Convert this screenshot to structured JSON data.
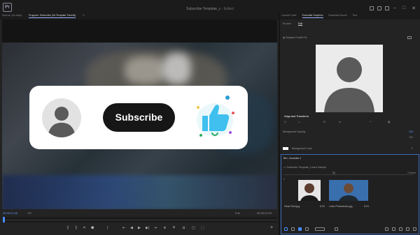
{
  "window": {
    "app_badge": "Pr",
    "title": "Subscribe Template_c",
    "title_suffix": "- Edited",
    "controls": [
      "–",
      "□",
      "✕"
    ]
  },
  "left_tabs": [
    {
      "label": "Source: (no clips)",
      "active": false
    },
    {
      "label": "Program: Subscribe (3d Template Tutorial)",
      "active": true
    }
  ],
  "right_tabs": [
    {
      "label": "Lumetri Color",
      "active": false
    },
    {
      "label": "Essential Graphics",
      "active": true
    },
    {
      "label": "Essential Sound",
      "active": false
    },
    {
      "label": "Text",
      "active": false
    }
  ],
  "overlay": {
    "subscribe_label": "Subscribe",
    "colors": {
      "card": "#ffffff",
      "button": "#161616",
      "like": "#3fc0ef",
      "avatar": "#5a5a5a"
    }
  },
  "program_monitor": {
    "timecode_current": "00:00:21:06",
    "fit_label": "Fit",
    "quality_label": "Full",
    "timecode_duration": "00:00:23:19"
  },
  "transport_icons": [
    "mark-in-icon",
    "mark-out-icon",
    "go-to-in-icon",
    "step-back-icon",
    "play-icon",
    "step-forward-icon",
    "go-to-out-icon",
    "lift-icon",
    "extract-icon",
    "export-frame-icon",
    "add-icon"
  ],
  "essential_graphics": {
    "subtabs": [
      {
        "label": "Browse",
        "active": false
      },
      {
        "label": "Edit",
        "active": true
      }
    ],
    "layer_name": "Replace Profile Pic",
    "align_label": "Align and Transform",
    "properties": [
      {
        "label": "Background Opacity",
        "value": "100"
      },
      {
        "label": "",
        "value": "100"
      }
    ],
    "background_color_label": "Background Color",
    "colors": {
      "preview_bg": "#ebebeb",
      "silhouette": "#5a5a5a",
      "accent": "#5e9bff"
    }
  },
  "project_panel": {
    "title": "Bin: Journals",
    "path": "Subscribe Template_Luisrd Sample",
    "item_count": "2 Items",
    "items": [
      {
        "name": "Head Shot.jpg",
        "duration": "5:23"
      },
      {
        "name": "Luisn Photostudio.jpg",
        "duration": "5:23"
      }
    ],
    "colors": {
      "border": "#3a6db8"
    }
  }
}
